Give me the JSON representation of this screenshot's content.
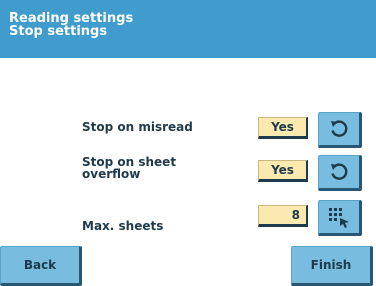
{
  "header": {
    "title": "Reading settings",
    "subtitle": "Stop settings"
  },
  "settings": [
    {
      "label": "Stop on misread",
      "value": "Yes",
      "icon": "reset-icon"
    },
    {
      "label_line1": "Stop on sheet",
      "label_line2": "overflow",
      "value": "Yes",
      "icon": "reset-icon"
    },
    {
      "label": "Max. sheets",
      "value": "8",
      "icon": "keypad-icon"
    }
  ],
  "footer": {
    "back_label": "Back",
    "finish_label": "Finish"
  },
  "colors": {
    "header_bg": "#3f9ccd",
    "button_bg": "#78bde0",
    "value_bg": "#fbe9b0",
    "text": "#1f3b4b"
  }
}
